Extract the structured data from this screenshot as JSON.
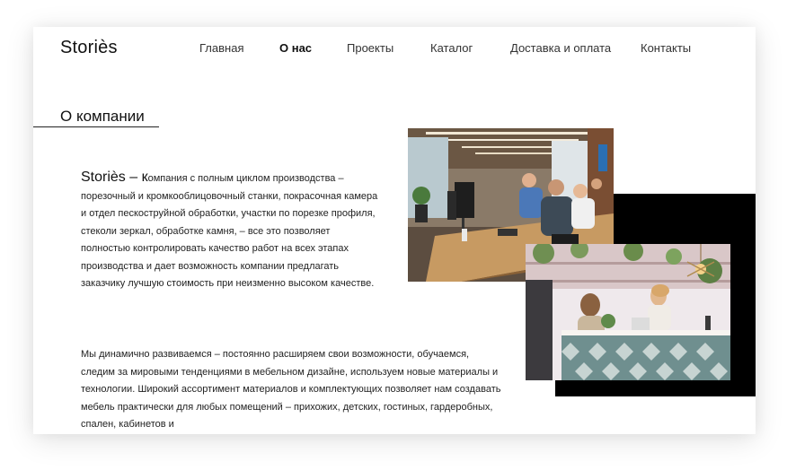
{
  "header": {
    "logo": "Storiès",
    "nav": [
      {
        "label": "Главная",
        "active": false
      },
      {
        "label": "О нас",
        "active": true
      },
      {
        "label": "Проекты",
        "active": false
      },
      {
        "label": "Каталог",
        "active": false
      },
      {
        "label": "Доставка и оплата",
        "active": false
      },
      {
        "label": "Контакты",
        "active": false
      }
    ]
  },
  "section": {
    "title": "О компании"
  },
  "intro": {
    "brand": "Storiès",
    "dash": " – к",
    "text": "омпания с  полным циклом производства – порезочный и кромкооблицовочный станки, покрасочная камера и отдел пескоструйной обработки, участки по порезке профиля, стеколи зеркал, обработке камня, – все это позволяет полностью контролировать качество работ на всех этапах производства и дает возможность компании предлагать заказчику лучшую стоимость при неизменно высоком качестве."
  },
  "paragraph2": {
    "text": "Мы динамично развиваемся – постоянно расширяем свои возможности, обучаемся, следим за мировыми тенденциями в мебельном дизайне, используем новые материалы и технологии. Широкий ассортимент материалов и комплектующих позволяет нам создавать мебель практически для любых помещений – прихожих, детских, гостиных, гардеробных, спален, кабинетов и"
  },
  "colors": {
    "accent_block": "#000000",
    "text": "#222222"
  },
  "images": {
    "office_photo": "office-workspace-photo",
    "reception_photo": "reception-desk-photo"
  }
}
